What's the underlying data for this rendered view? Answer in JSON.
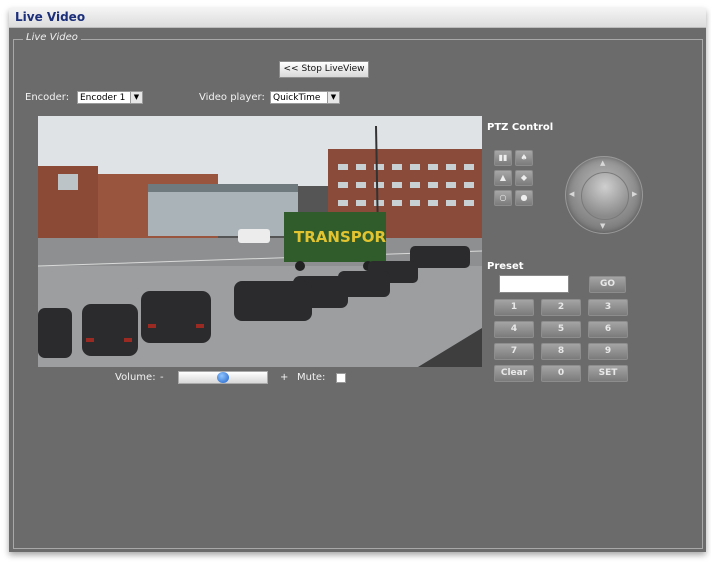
{
  "window": {
    "title": "Live Video"
  },
  "section": {
    "legend": "Live Video"
  },
  "controls": {
    "stop_button": "<< Stop LiveView",
    "encoder_label": "Encoder:",
    "encoder_value": "Encoder 1",
    "player_label": "Video player:",
    "player_value": "QuickTime"
  },
  "ptz": {
    "title": "PTZ Control",
    "buttons": [
      "zoom-in",
      "zoom-out",
      "focus-near",
      "focus-far",
      "iris-open",
      "iris-close"
    ]
  },
  "preset": {
    "title": "Preset",
    "value": "",
    "go_label": "GO",
    "keys": [
      "1",
      "2",
      "3",
      "4",
      "5",
      "6",
      "7",
      "8",
      "9",
      "Clear",
      "0",
      "SET"
    ]
  },
  "audio": {
    "volume_label": "Volume:",
    "volume_minus": "-",
    "volume_plus": "+",
    "volume_level": 0.5,
    "mute_label": "Mute:",
    "mute_checked": false
  },
  "video": {
    "truck_text": "TRANSPOR"
  }
}
